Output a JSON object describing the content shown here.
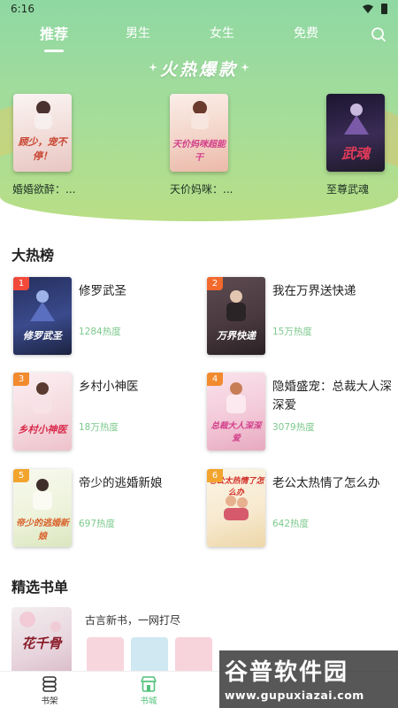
{
  "status_bar": {
    "time": "6:16"
  },
  "top_nav": {
    "tabs": [
      {
        "label": "推荐",
        "active": true
      },
      {
        "label": "男生",
        "active": false
      },
      {
        "label": "女生",
        "active": false
      },
      {
        "label": "免费",
        "active": false
      }
    ]
  },
  "hot": {
    "title": "火热爆款",
    "books": [
      {
        "title": "婚婚欲醉：...",
        "cover_text": "顾少，宠不停！",
        "color": "#f4e9e6"
      },
      {
        "title": "天价妈咪：...",
        "cover_text": "天价妈咪超能干",
        "color": "#f3d4c8"
      },
      {
        "title": "至尊武魂",
        "cover_text": "武魂",
        "color": "#2a1f3a"
      }
    ]
  },
  "ranking": {
    "title": "大热榜",
    "items": [
      {
        "rank": "1",
        "name": "修罗武圣",
        "heat": "1284热度",
        "badge_color": "#f2493a",
        "cover_color": "#3a4a8c",
        "cover_text": "修罗武圣"
      },
      {
        "rank": "2",
        "name": "我在万界送快递",
        "heat": "15万热度",
        "badge_color": "#f26a2e",
        "cover_color": "#4a3a3f",
        "cover_text": "万界快递"
      },
      {
        "rank": "3",
        "name": "乡村小神医",
        "heat": "18万热度",
        "badge_color": "#f28a2e",
        "cover_color": "#f5dbe0",
        "cover_text": "乡村小神医"
      },
      {
        "rank": "4",
        "name": "隐婚盛宠：总裁大人深深爱",
        "heat": "3079热度",
        "badge_color": "#f28a2e",
        "cover_color": "#f3c9d8",
        "cover_text": "总裁大人深深爱"
      },
      {
        "rank": "5",
        "name": "帝少的逃婚新娘",
        "heat": "697热度",
        "badge_color": "#f2a42e",
        "cover_color": "#eef3dc",
        "cover_text": "帝少的逃婚新娘"
      },
      {
        "rank": "6",
        "name": "老公太热情了怎么办",
        "heat": "642热度",
        "badge_color": "#f2a42e",
        "cover_color": "#f7ead0",
        "cover_text": "老公太热情了怎么办"
      }
    ]
  },
  "booklist": {
    "title": "精选书单",
    "description": "古言新书，一网打尽",
    "cover_text": "花千骨"
  },
  "bottom_nav": {
    "items": [
      {
        "label": "书架",
        "active": false
      },
      {
        "label": "书城",
        "active": true
      }
    ]
  },
  "watermark": {
    "title": "谷普软件园",
    "url": "www.gupuxiazai.com"
  },
  "colors": {
    "accent": "#52c27b",
    "heat": "#7cc98c",
    "hero_top": "#8fd8a3",
    "hero_bottom": "#b9de86"
  }
}
